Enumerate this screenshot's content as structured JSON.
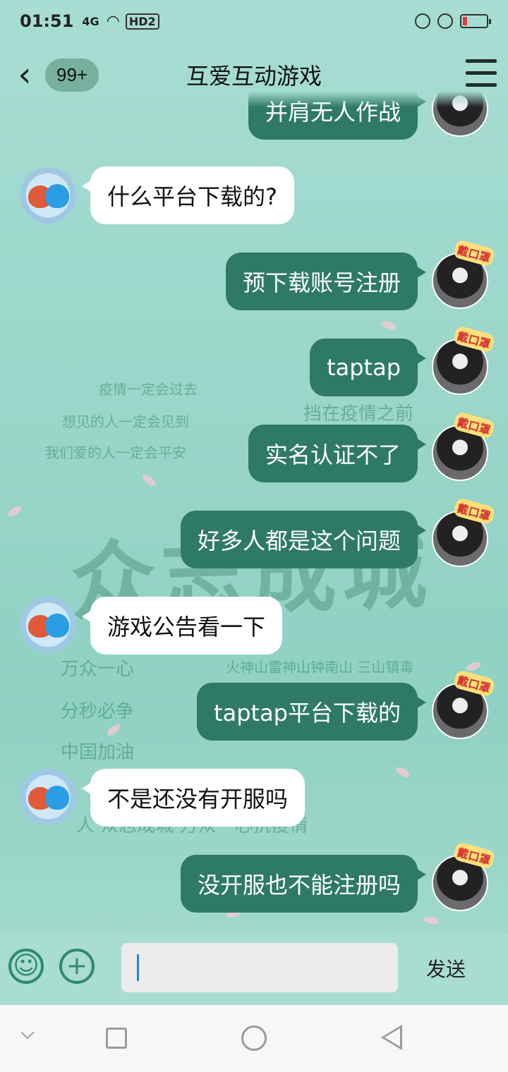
{
  "status_bar": {
    "time": "01:51",
    "signal": "4G",
    "hd": "HD2"
  },
  "header": {
    "unread_badge": "99+",
    "title": "互爱互动游戏"
  },
  "background_text": {
    "line1": "疫情一定会过去",
    "line2": "想见的人一定会见到",
    "line3": "我们爱的人一定会平安",
    "line4": "挡在疫情之前",
    "big": "众志成城",
    "left1": "万众一心",
    "left2": "分秒必争",
    "left3": "中国加油",
    "mid": "火神山雷神山钟南山 三山镇毒",
    "bottom": "人 众志成城  万众一心抗疫情"
  },
  "messages": [
    {
      "side": "right",
      "text": "并肩无人作战"
    },
    {
      "side": "left",
      "text": "什么平台下载的?"
    },
    {
      "side": "right",
      "text": "预下载账号注册"
    },
    {
      "side": "right",
      "text": "taptap"
    },
    {
      "side": "right",
      "text": "实名认证不了"
    },
    {
      "side": "right",
      "text": "好多人都是这个问题"
    },
    {
      "side": "left",
      "text": "游戏公告看一下"
    },
    {
      "side": "right",
      "text": "taptap平台下载的"
    },
    {
      "side": "left",
      "text": "不是还没有开服吗"
    },
    {
      "side": "right",
      "text": "没开服也不能注册吗"
    }
  ],
  "input": {
    "placeholder": "",
    "value": "",
    "send_label": "发送"
  },
  "colors": {
    "accent": "#2f7a66",
    "background": "#9fd8cc"
  }
}
